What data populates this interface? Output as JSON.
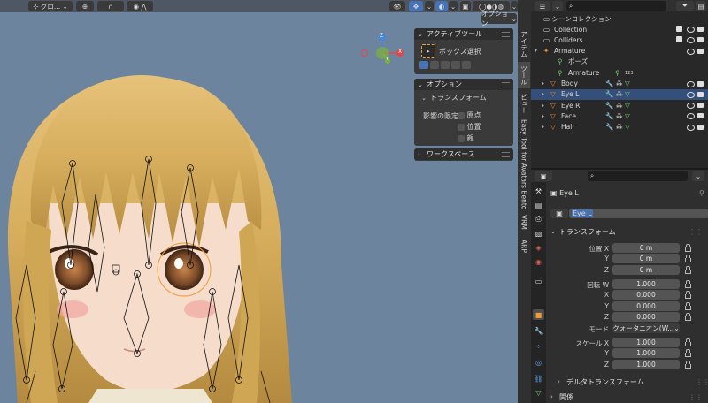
{
  "viewport": {
    "header": {
      "transform_orientation": "グロ...",
      "options_label": "オプション"
    },
    "active_tool_panel": {
      "title": "アクティブツール",
      "tool_name": "ボックス選択"
    },
    "options_panel": {
      "title": "オプション",
      "transform_title": "トランスフォーム",
      "affect_only": "影響の限定",
      "checkboxes": [
        "原点",
        "位置",
        "親"
      ]
    },
    "workspace_panel": {
      "title": "ワークスペース"
    },
    "gizmo": {
      "z": "Z",
      "x": "X",
      "y": "Y"
    },
    "vertical_tabs": [
      "アイテム",
      "ツール",
      "ビュー",
      "Easy Tool for Avatars Bento",
      "VRM",
      "ARP"
    ]
  },
  "outliner": {
    "root": "シーンコレクション",
    "items": [
      {
        "label": "Collection",
        "type": "collection"
      },
      {
        "label": "Colliders",
        "type": "collection"
      },
      {
        "label": "Armature",
        "type": "armature"
      },
      {
        "label": "ポーズ",
        "type": "pose"
      },
      {
        "label": "Armature",
        "type": "armature-data",
        "badge": "123"
      },
      {
        "label": "Body",
        "type": "mesh"
      },
      {
        "label": "Eye L",
        "type": "mesh",
        "selected": true
      },
      {
        "label": "Eye R",
        "type": "mesh"
      },
      {
        "label": "Face",
        "type": "mesh"
      },
      {
        "label": "Hair",
        "type": "mesh"
      }
    ]
  },
  "properties": {
    "object_name": "Eye L",
    "name_field": "Eye L",
    "transform_section": "トランスフォーム",
    "location_label": "位置 X",
    "location": [
      {
        "axis": "X",
        "value": "0 m"
      },
      {
        "axis": "Y",
        "value": "0 m"
      },
      {
        "axis": "Z",
        "value": "0 m"
      }
    ],
    "rotation_label": "回転 W",
    "rotation": [
      {
        "axis": "W",
        "value": "1.000"
      },
      {
        "axis": "X",
        "value": "0.000"
      },
      {
        "axis": "Y",
        "value": "0.000"
      },
      {
        "axis": "Z",
        "value": "0.000"
      }
    ],
    "mode_label": "モード",
    "mode_value": "クォータニオン(W...",
    "scale_label": "スケール X",
    "scale": [
      {
        "axis": "X",
        "value": "1.000"
      },
      {
        "axis": "Y",
        "value": "1.000"
      },
      {
        "axis": "Z",
        "value": "1.000"
      }
    ],
    "delta_section": "デルタトランスフォーム",
    "relations_section": "関係"
  },
  "colors": {
    "accent": "#4772b3",
    "selected_row": "#344f7a",
    "mesh_icon": "#6bd36b",
    "object_icon": "#e98a2d"
  }
}
